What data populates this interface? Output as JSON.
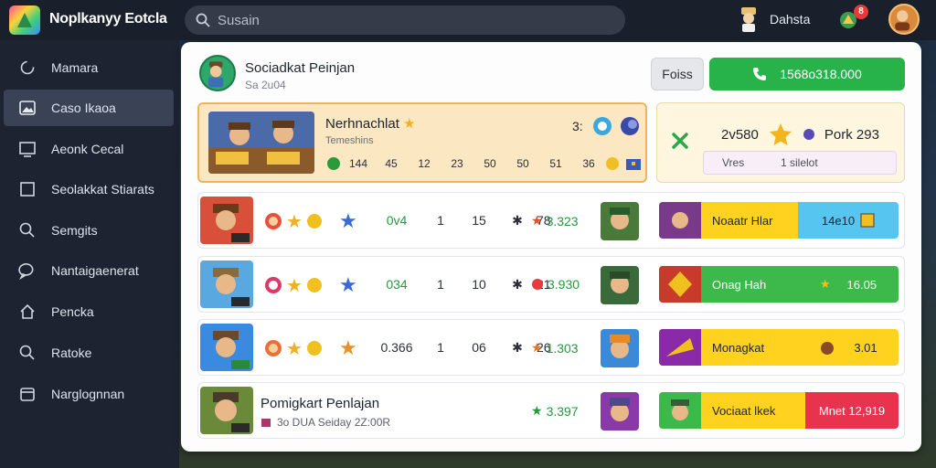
{
  "topbar": {
    "app_title": "Noplkanyy Eotcla",
    "search_placeholder": "Susain",
    "user_label": "Dahsta",
    "notif_count": "8"
  },
  "sidebar": {
    "items": [
      {
        "label": "Mamara",
        "icon": "refresh-icon",
        "active": false
      },
      {
        "label": "Caso Ikaoa",
        "icon": "image-icon",
        "active": true
      },
      {
        "label": "Aeonk Cecal",
        "icon": "monitor-icon",
        "active": false
      },
      {
        "label": "Seolakkat Stiarats",
        "icon": "square-icon",
        "active": false
      },
      {
        "label": "Semgits",
        "icon": "search-icon",
        "active": false
      },
      {
        "label": "Nantaigaenerat",
        "icon": "chat-icon",
        "active": false
      },
      {
        "label": "Pencka",
        "icon": "home-icon",
        "active": false
      },
      {
        "label": "Ratoke",
        "icon": "search-icon",
        "active": false
      },
      {
        "label": "Narglognnan",
        "icon": "calendar-icon",
        "active": false
      }
    ]
  },
  "header": {
    "title": "Sociadkat Peinjan",
    "subtitle": "Sa 2u04",
    "gray_button": "Foiss",
    "green_button": "1568o318.000"
  },
  "featured": {
    "title": "Nerhnachlat",
    "subtitle": "Temeshins",
    "stats": [
      "144",
      "45",
      "12",
      "23",
      "50",
      "50",
      "51",
      "36"
    ],
    "number": "3:"
  },
  "info": {
    "value": "2v580",
    "label": "Pork 293",
    "pill_left": "Vres",
    "pill_right": "1 silelot"
  },
  "rows": [
    {
      "stat_g": "0v4",
      "stat_1": "1",
      "stat_2": "15",
      "stat_3": "78",
      "score": "3.323",
      "act_label": "Noaatr Hlar",
      "act_value": "14e10",
      "act_color": "#ffd21f",
      "val_color": "#56c5f0"
    },
    {
      "stat_g": "034",
      "stat_1": "1",
      "stat_2": "10",
      "stat_3": "21",
      "score": "3.930",
      "act_label": "Onag Hah",
      "act_value": "16.05",
      "act_color": "#3cb94a",
      "val_color": "#3cb94a"
    },
    {
      "stat_g": "0.366",
      "stat_1": "1",
      "stat_2": "06",
      "stat_3": "26",
      "score": "1.303",
      "act_label": "Monagkat",
      "act_value": "3.01",
      "act_color": "#ffd21f",
      "val_color": "#ffd21f"
    }
  ],
  "last_row": {
    "title": "Pomigkart Penlajan",
    "subtitle": "3o DUA Seiday 2Z:00R",
    "score": "3.397",
    "act_label": "Vociaat lkek",
    "act_value": "Mnet 12,919"
  }
}
